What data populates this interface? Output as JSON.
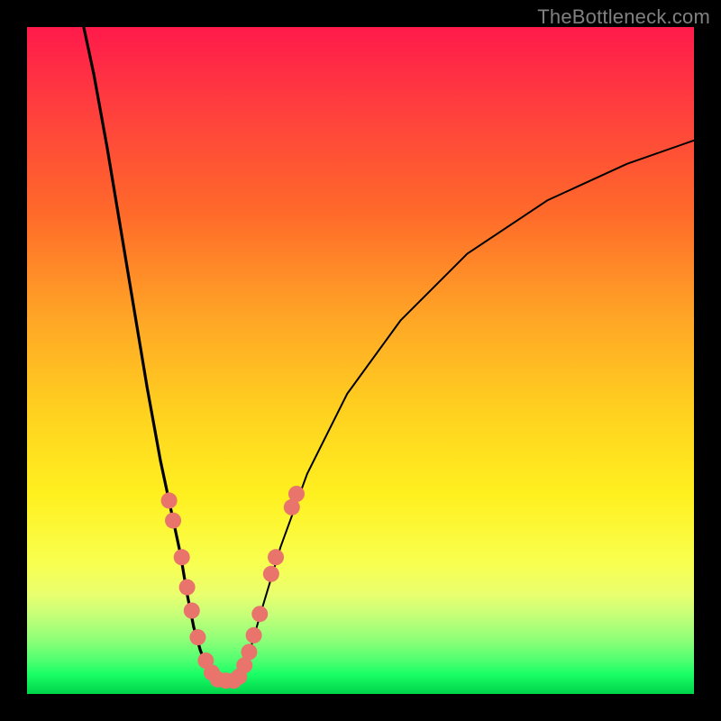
{
  "watermark": "TheBottleneck.com",
  "chart_data": {
    "type": "line",
    "title": "",
    "xlabel": "",
    "ylabel": "",
    "xlim": [
      0,
      100
    ],
    "ylim": [
      0,
      100
    ],
    "grid": false,
    "legend": false,
    "series": [
      {
        "name": "left-curve",
        "stroke_width": 3.2,
        "x": [
          8.5,
          10,
          12,
          14,
          16,
          18,
          20,
          21.5,
          23,
          24,
          25,
          26,
          27,
          28,
          28.5
        ],
        "y": [
          100,
          93,
          82,
          70,
          58,
          46,
          35,
          28,
          21,
          15,
          10,
          6.5,
          4,
          2.5,
          2
        ]
      },
      {
        "name": "flat-bottom",
        "stroke_width": 3.2,
        "x": [
          28.5,
          31.5
        ],
        "y": [
          2,
          2
        ]
      },
      {
        "name": "right-curve",
        "stroke_width": 2.0,
        "x": [
          31.5,
          33,
          35,
          38,
          42,
          48,
          56,
          66,
          78,
          90,
          100
        ],
        "y": [
          2,
          5,
          12,
          22,
          33,
          45,
          56,
          66,
          74,
          79.5,
          83
        ]
      }
    ],
    "markers": {
      "name": "highlight-dots",
      "color": "#e8746b",
      "radius_px": 9,
      "points": [
        {
          "x": 21.3,
          "y": 29
        },
        {
          "x": 21.9,
          "y": 26
        },
        {
          "x": 23.2,
          "y": 20.5
        },
        {
          "x": 24.0,
          "y": 16
        },
        {
          "x": 24.7,
          "y": 12.5
        },
        {
          "x": 25.6,
          "y": 8.5
        },
        {
          "x": 26.8,
          "y": 5
        },
        {
          "x": 27.7,
          "y": 3.2
        },
        {
          "x": 28.6,
          "y": 2.2
        },
        {
          "x": 29.8,
          "y": 2
        },
        {
          "x": 31.0,
          "y": 2
        },
        {
          "x": 31.8,
          "y": 2.6
        },
        {
          "x": 32.6,
          "y": 4.3
        },
        {
          "x": 33.3,
          "y": 6.3
        },
        {
          "x": 34.0,
          "y": 8.8
        },
        {
          "x": 34.9,
          "y": 12.0
        },
        {
          "x": 36.6,
          "y": 18.0
        },
        {
          "x": 37.3,
          "y": 20.5
        },
        {
          "x": 39.7,
          "y": 28.0
        },
        {
          "x": 40.4,
          "y": 30.0
        }
      ]
    },
    "background_gradient": {
      "direction": "top-to-bottom",
      "stops": [
        {
          "pos": 0.0,
          "color": "#ff1a4b"
        },
        {
          "pos": 0.12,
          "color": "#ff3e3e"
        },
        {
          "pos": 0.28,
          "color": "#ff6a2a"
        },
        {
          "pos": 0.44,
          "color": "#ffa726"
        },
        {
          "pos": 0.58,
          "color": "#ffd21f"
        },
        {
          "pos": 0.7,
          "color": "#fff01f"
        },
        {
          "pos": 0.8,
          "color": "#f9ff4d"
        },
        {
          "pos": 0.85,
          "color": "#eaff6e"
        },
        {
          "pos": 0.88,
          "color": "#c8ff78"
        },
        {
          "pos": 0.92,
          "color": "#8cff78"
        },
        {
          "pos": 0.95,
          "color": "#4fff70"
        },
        {
          "pos": 0.97,
          "color": "#1aff66"
        },
        {
          "pos": 1.0,
          "color": "#00d44a"
        }
      ]
    }
  }
}
